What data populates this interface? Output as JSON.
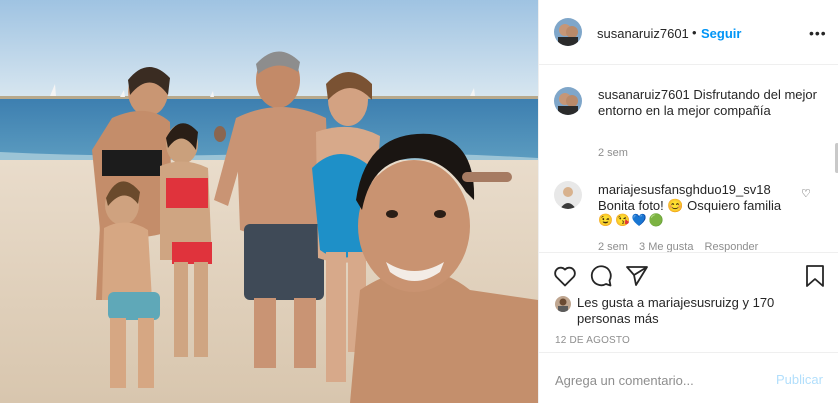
{
  "post": {
    "photo_icon": "beach-family-selfie-photo"
  },
  "header": {
    "username": "susanaruiz7601",
    "separator": "•",
    "follow_label": "Seguir",
    "more_icon": "ellipsis-icon"
  },
  "comments": [
    {
      "username": "susanaruiz7601",
      "text": "Disfrutando del mejor entorno en la mejor compañía",
      "time": "2 sem"
    },
    {
      "username": "mariajesusfansghduo19_sv18",
      "text": "Bonita foto! 😊 Osquiero familia",
      "emojis": "😉😘💙🟢",
      "time": "2 sem",
      "likes": "3 Me gusta",
      "reply_label": "Responder"
    }
  ],
  "actions": {
    "like_icon": "heart-icon",
    "comment_icon": "comment-icon",
    "share_icon": "paper-plane-icon",
    "save_icon": "bookmark-icon"
  },
  "likes": {
    "text": "Les gusta a mariajesusruizg y 170 personas más"
  },
  "date": "12 DE AGOSTO",
  "add_comment": {
    "placeholder": "Agrega un comentario...",
    "publish_label": "Publicar"
  },
  "colors": {
    "accent": "#0095f6",
    "publish_disabled": "#b2dffc",
    "muted": "#8e8e8e",
    "text": "#262626"
  }
}
